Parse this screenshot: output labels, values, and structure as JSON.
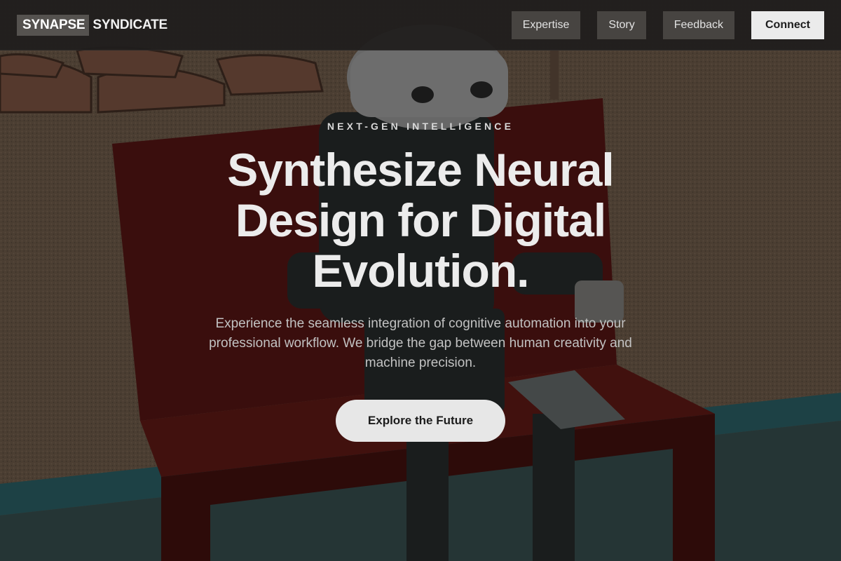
{
  "brand": {
    "name_part1": "SYNAPSE",
    "name_part2": "SYNDICATE"
  },
  "nav": {
    "items": [
      {
        "label": "Expertise"
      },
      {
        "label": "Story"
      },
      {
        "label": "Feedback"
      }
    ],
    "cta_label": "Connect"
  },
  "hero": {
    "eyebrow": "NEXT-GEN INTELLIGENCE",
    "headline": "Synthesize Neural Design for Digital Evolution.",
    "subtext": "Experience the seamless integration of cognitive automation into your professional workflow. We bridge the gap between human creativity and machine precision.",
    "button_label": "Explore the Future"
  },
  "colors": {
    "nav_bg": "#201e1d",
    "logo_block": "#55524f",
    "nav_button": "#474441",
    "cta_button": "#ebebeb",
    "hero_button": "#e7e7e7"
  }
}
